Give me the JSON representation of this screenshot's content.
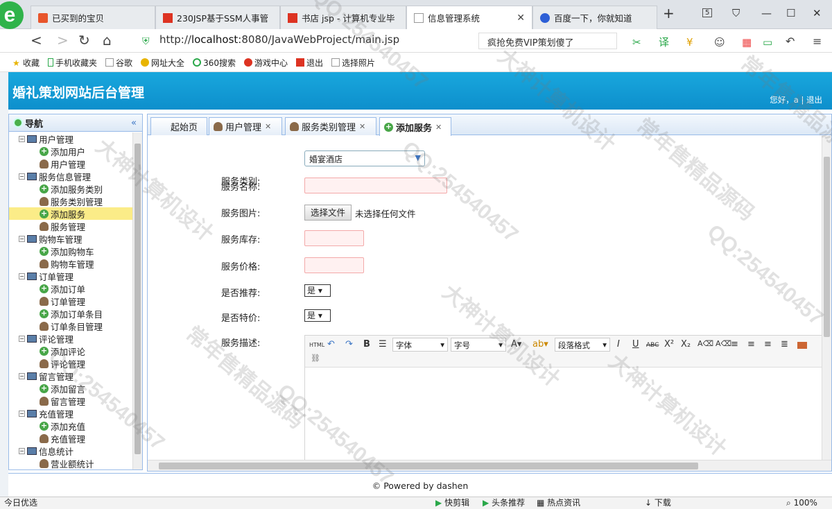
{
  "browser": {
    "tabs": [
      {
        "label": "已买到的宝贝"
      },
      {
        "label": "230JSP基于SSM人事管"
      },
      {
        "label": "书店 jsp - 计算机专业毕"
      },
      {
        "label": "信息管理系统",
        "active": true
      },
      {
        "label": "百度一下，你就知道"
      }
    ],
    "tab_count": "5",
    "url_prefix": "http://",
    "url_host": "localhost",
    "url_rest": ":8080/JavaWebProject/main.jsp",
    "search_text": "疯抢免费VIP策划傻了",
    "bookmarks": [
      "收藏",
      "手机收藏夹",
      "谷歌",
      "网址大全",
      "360搜索",
      "游戏中心",
      "退出",
      "选择照片"
    ]
  },
  "app": {
    "title": "婚礼策划网站后台管理",
    "greeting": "您好，a",
    "separator": "|",
    "logout": "退出"
  },
  "sidebar": {
    "title": "导航",
    "collapse": "«",
    "groups": [
      {
        "label": "用户管理",
        "children": [
          "添加用户",
          "用户管理"
        ]
      },
      {
        "label": "服务信息管理",
        "children": [
          "添加服务类别",
          "服务类别管理",
          "添加服务",
          "服务管理"
        ]
      },
      {
        "label": "购物车管理",
        "children": [
          "添加购物车",
          "购物车管理"
        ]
      },
      {
        "label": "订单管理",
        "children": [
          "添加订单",
          "订单管理",
          "添加订单条目",
          "订单条目管理"
        ]
      },
      {
        "label": "评论管理",
        "children": [
          "添加评论",
          "评论管理"
        ]
      },
      {
        "label": "留言管理",
        "children": [
          "添加留言",
          "留言管理"
        ]
      },
      {
        "label": "充值管理",
        "children": [
          "添加充值",
          "充值管理"
        ]
      },
      {
        "label": "信息统计",
        "children": [
          "营业额统计"
        ]
      }
    ]
  },
  "tabs": [
    {
      "label": "起始页"
    },
    {
      "label": "用户管理"
    },
    {
      "label": "服务类别管理"
    },
    {
      "label": "添加服务",
      "active": true
    }
  ],
  "form": {
    "category_label": "服务类别:",
    "category_value": "婚宴酒店",
    "name_label": "服务名称:",
    "image_label": "服务图片:",
    "file_button": "选择文件",
    "file_status": "未选择任何文件",
    "stock_label": "服务库存:",
    "price_label": "服务价格:",
    "recommend_label": "是否推荐:",
    "recommend_value": "是",
    "special_label": "是否特价:",
    "special_value": "是",
    "desc_label": "服务描述:"
  },
  "editor": {
    "font_family": "字体",
    "font_size": "字号",
    "paragraph": "段落格式",
    "html_label": "HTML"
  },
  "footer": "© Powered by dashen",
  "status": {
    "left": "今日优选",
    "items": [
      "快剪辑",
      "头条推荐",
      "热点资讯",
      "下载"
    ],
    "zoom": "100%"
  },
  "watermarks": [
    "QQ:254540457",
    "大神计算机设计",
    "常年售精品源码"
  ]
}
